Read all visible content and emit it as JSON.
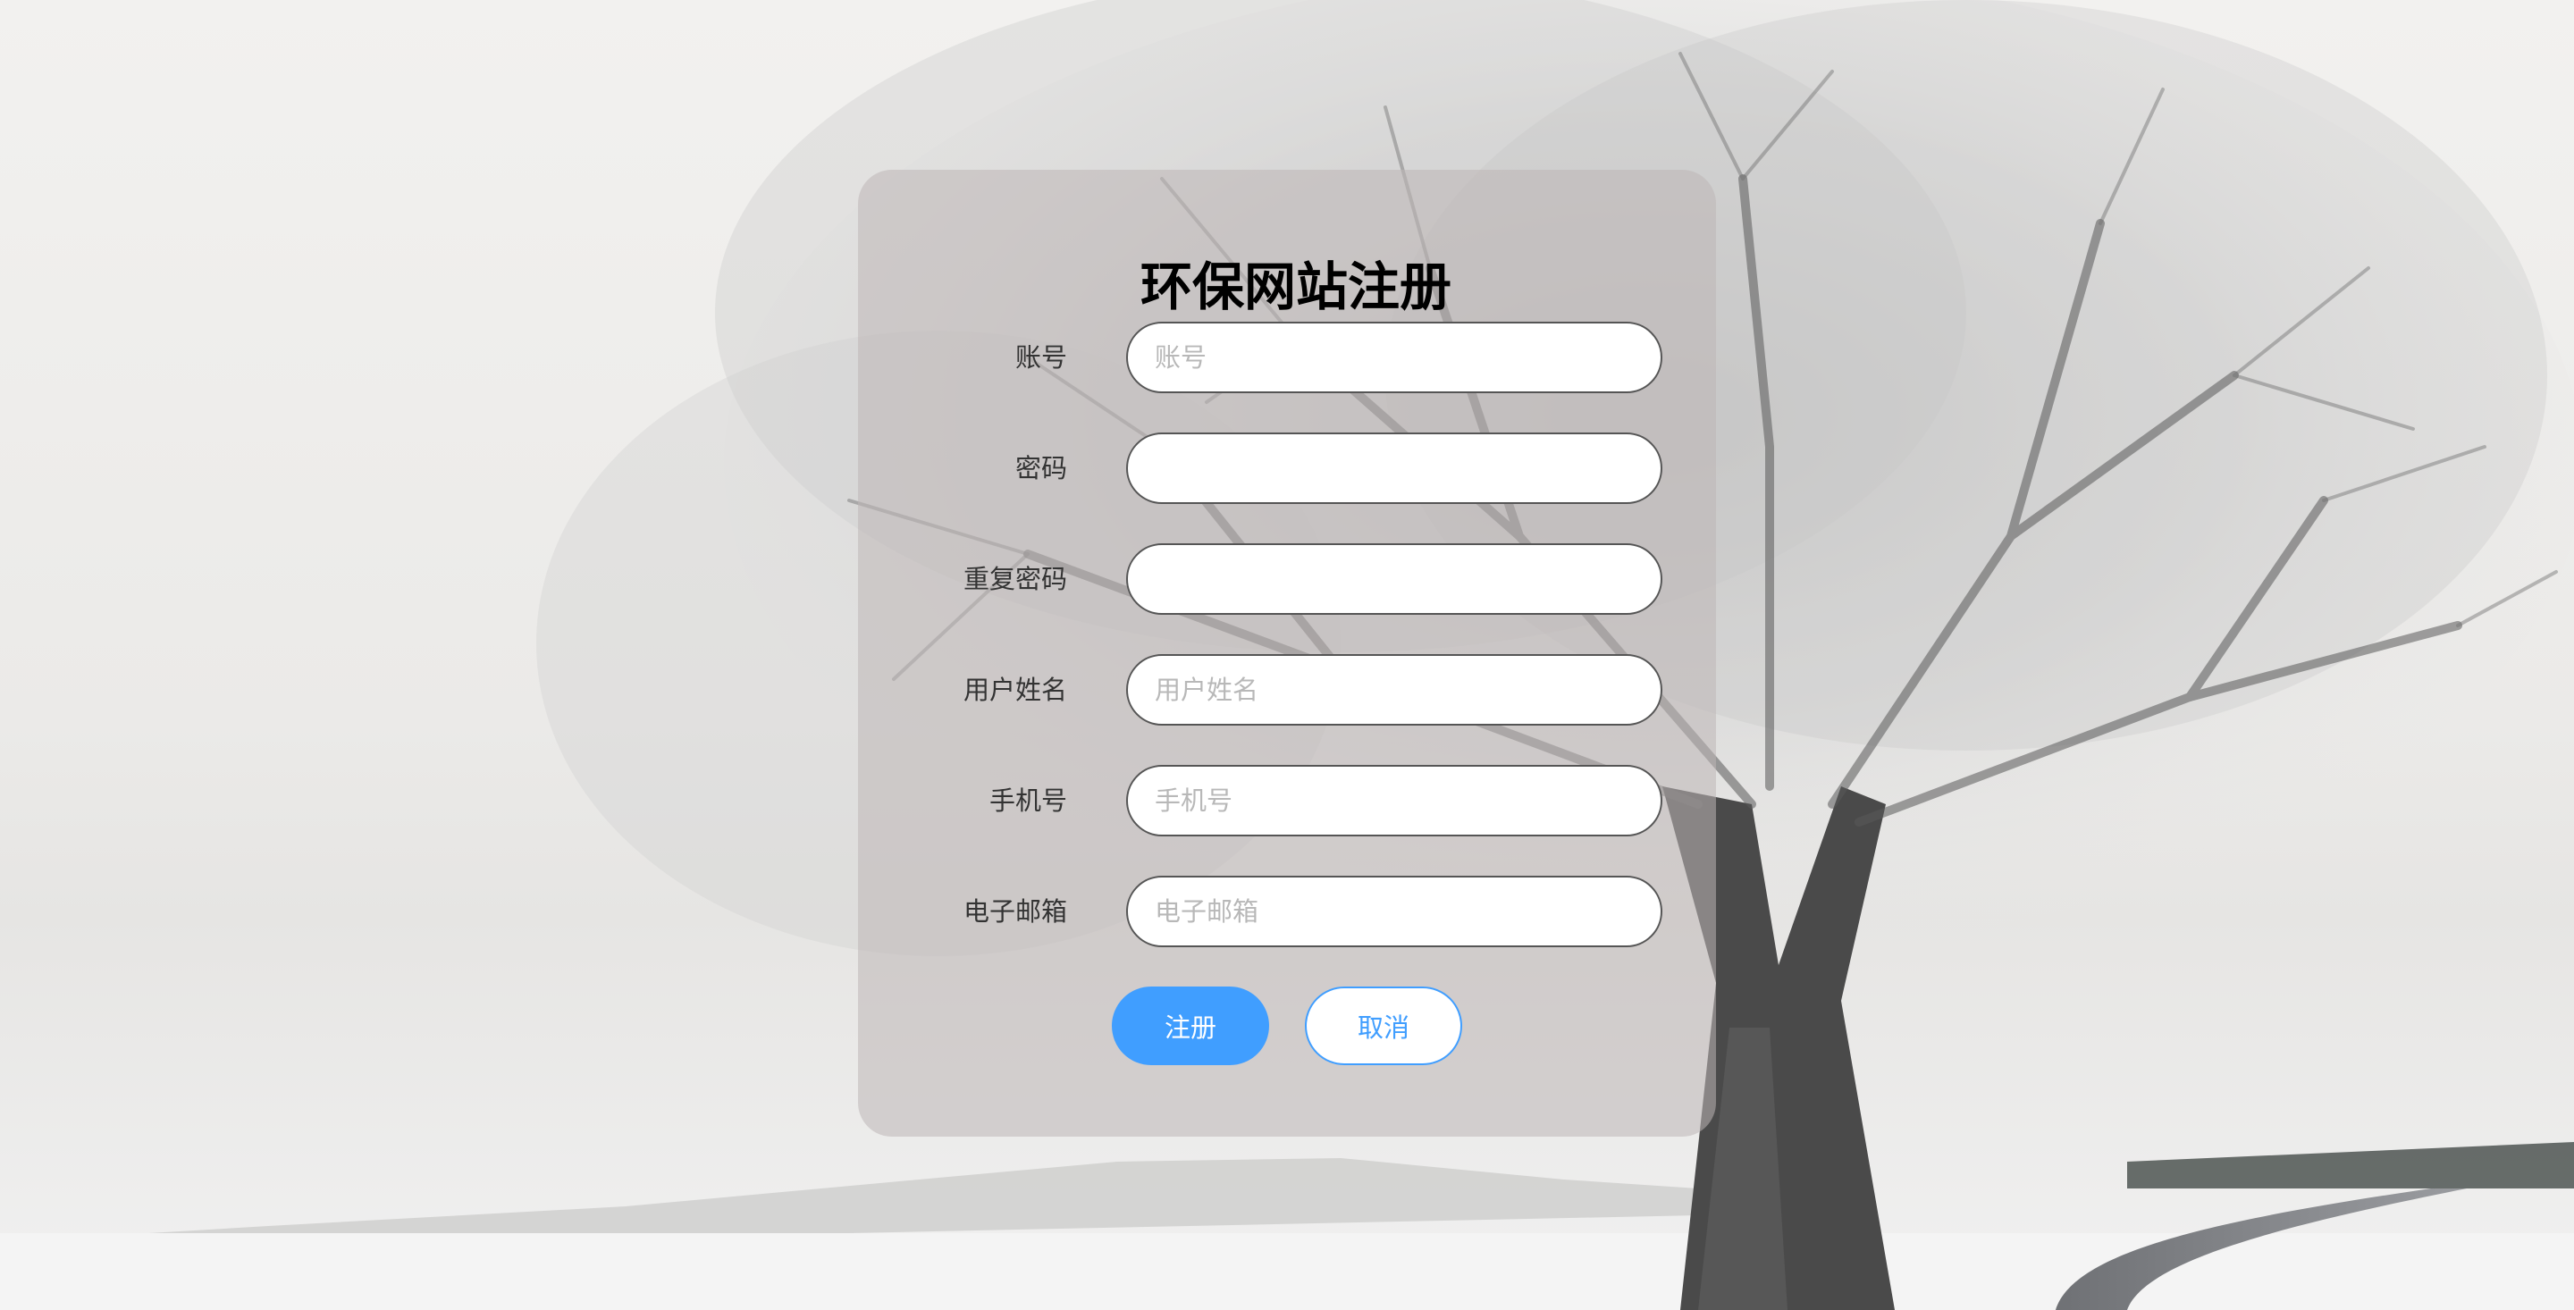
{
  "background": {
    "description_icon": "snowy-tree-landscape",
    "sky_color": "#f0efed",
    "snow_color": "#f3f3f3"
  },
  "form": {
    "title": "环保网站注册",
    "fields": [
      {
        "label": "账号",
        "placeholder": "账号",
        "value": ""
      },
      {
        "label": "密码",
        "placeholder": "",
        "value": ""
      },
      {
        "label": "重复密码",
        "placeholder": "",
        "value": ""
      },
      {
        "label": "用户姓名",
        "placeholder": "用户姓名",
        "value": ""
      },
      {
        "label": "手机号",
        "placeholder": "手机号",
        "value": ""
      },
      {
        "label": "电子邮箱",
        "placeholder": "电子邮箱",
        "value": ""
      }
    ],
    "submit_label": "注册",
    "cancel_label": "取消",
    "accent_color": "#409eff"
  }
}
